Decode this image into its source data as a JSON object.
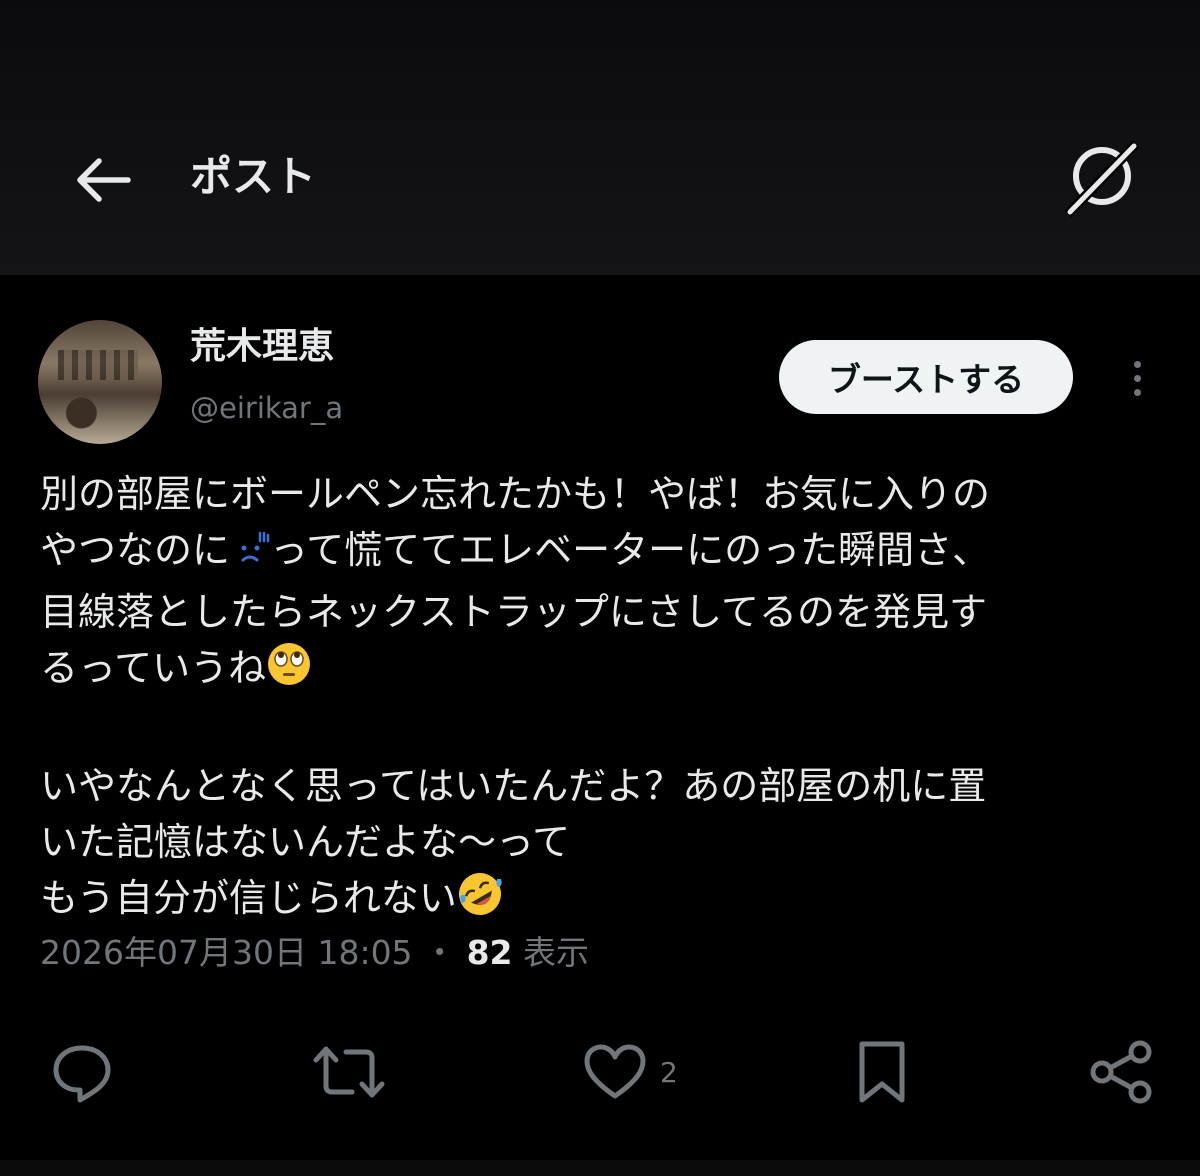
{
  "header": {
    "title": "ポスト",
    "back_icon": "arrow-left-icon",
    "grok_icon": "grok-icon"
  },
  "author": {
    "display_name": "荒木理恵",
    "handle": "@eirikar_a",
    "avatar_icon": "avatar-photo"
  },
  "boost_button": {
    "label": "ブーストする"
  },
  "post": {
    "lines": [
      "別の部屋にボールペン忘れたかも！やば！お気に入りの",
      "やつなのに",
      "って慌ててエレベーターにのった瞬間さ、",
      "目線落としたらネックストラップにさしてるのを発見す",
      "るっていうね",
      "いやなんとなく思ってはいたんだよ？あの部屋の机に置",
      "いた記憶はないんだよな〜って",
      "もう自分が信じられない"
    ],
    "emojis": [
      "sweat-worried-emoji",
      "eye-roll-emoji",
      "rofl-emoji"
    ]
  },
  "meta": {
    "timestamp": "2026年07月30日 18:05",
    "separator": "・",
    "views_count": "82",
    "views_label": "表示"
  },
  "actions": {
    "reply_icon": "reply-icon",
    "repost_icon": "repost-icon",
    "like_icon": "heart-icon",
    "like_count": "2",
    "bookmark_icon": "bookmark-icon",
    "share_icon": "share-icon"
  },
  "colors": {
    "background": "#000000",
    "text": "#e7e9ea",
    "secondary": "#71767b",
    "button_bg": "#eff3f4",
    "emoji_blue": "#3d6fd8",
    "emoji_yellow": "#f7c630"
  }
}
